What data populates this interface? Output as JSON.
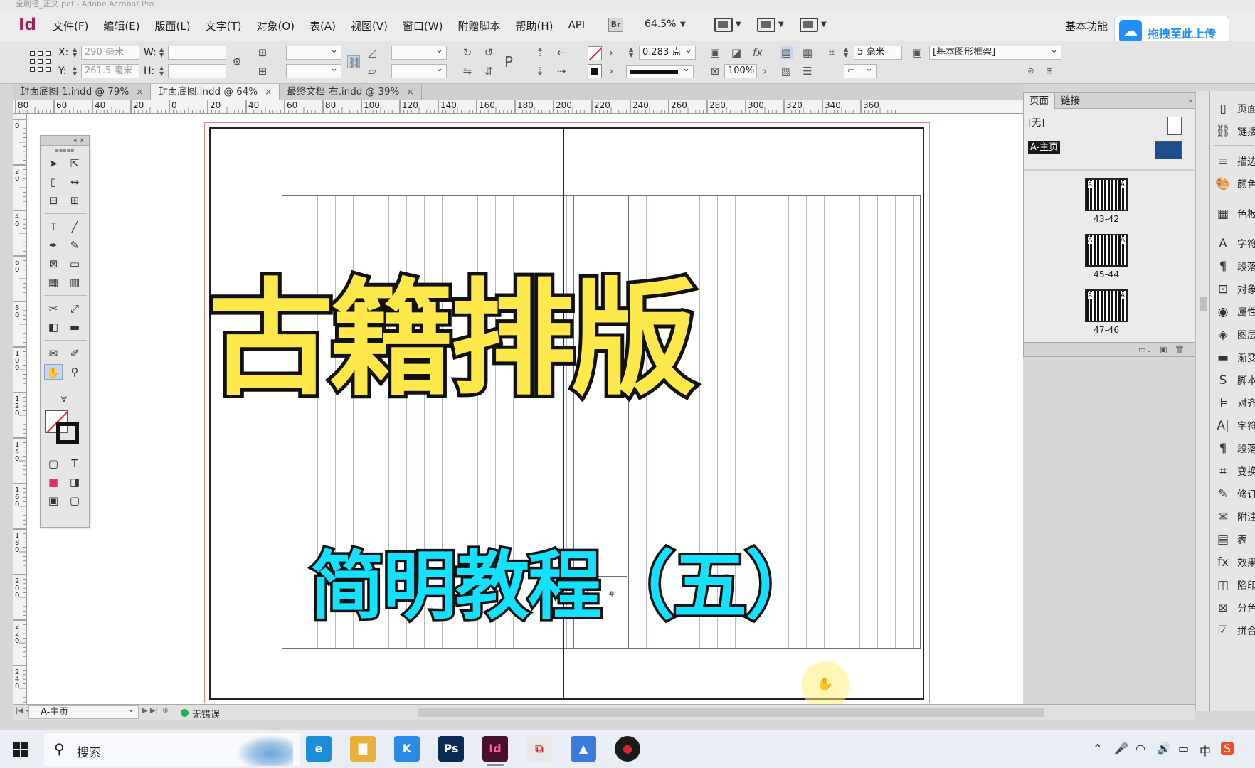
{
  "app": {
    "logo": "Id",
    "title_strip": "全刷径_正文.pdf - Adobe Acrobat Pro",
    "menus": [
      "文件(F)",
      "编辑(E)",
      "版面(L)",
      "文字(T)",
      "对象(O)",
      "表(A)",
      "视图(V)",
      "窗口(W)",
      "附赠脚本",
      "帮助(H)",
      "API"
    ],
    "bridge_badge": "Br",
    "zoom": "64.5%",
    "workspace": "基本功能",
    "upload_button": "拖拽至此上传"
  },
  "control": {
    "x_label": "X:",
    "x_value": "290 毫米",
    "y_label": "Y:",
    "y_value": "261.5 毫米",
    "w_label": "W:",
    "h_label": "H:",
    "stroke_weight": "0.283 点",
    "opacity": "100%",
    "offset": "5 毫米",
    "object_style": "[基本图形框架]"
  },
  "tabs": [
    {
      "label": "封面底图-1.indd @ 79%",
      "active": false
    },
    {
      "label": "封面底图.indd @ 64%",
      "active": true
    },
    {
      "label": "最终文档-右.indd @ 39%",
      "active": false
    }
  ],
  "ruler_h": [
    "80",
    "60",
    "40",
    "20",
    "0",
    "20",
    "40",
    "60",
    "80",
    "100",
    "120",
    "140",
    "160",
    "180",
    "200",
    "220",
    "240",
    "260",
    "280",
    "300",
    "320",
    "340",
    "360"
  ],
  "ruler_v": [
    "0",
    "20",
    "40",
    "60",
    "80",
    "100",
    "120",
    "140",
    "160",
    "180",
    "200",
    "220",
    "240"
  ],
  "canvas": {
    "title": "古籍排版",
    "subtitle": "简明教程（五）",
    "center_marks": [
      "#",
      "#"
    ],
    "title_color": "#ffe94a",
    "subtitle_color": "#14e0ff"
  },
  "pages_panel": {
    "tabs": [
      "页面",
      "链接"
    ],
    "masters": [
      "[无]",
      "A-主页"
    ],
    "spreads": [
      "43-42",
      "45-44",
      "47-46"
    ]
  },
  "dock": [
    "页面",
    "链接",
    "描边",
    "颜色",
    "色板",
    "字符",
    "段落",
    "对象",
    "属性",
    "图层",
    "渐变",
    "脚本",
    "对齐",
    "字符",
    "段落",
    "变换",
    "修订",
    "附注",
    "表",
    "效果",
    "陷印",
    "分色",
    "拼合"
  ],
  "status": {
    "page": "A-主页",
    "preflight": "无错误"
  },
  "taskbar": {
    "search": "搜索",
    "apps": [
      {
        "name": "edge",
        "glyph": "e",
        "color": "#1a8fd8"
      },
      {
        "name": "files",
        "glyph": "▇",
        "color": "#e8b23a"
      },
      {
        "name": "k-app",
        "glyph": "K",
        "color": "#2a8be6"
      },
      {
        "name": "photoshop",
        "glyph": "Ps",
        "color": "#0b2a55"
      },
      {
        "name": "indesign",
        "glyph": "Id",
        "color": "#4a0f2a"
      },
      {
        "name": "acrobat",
        "glyph": "⧉",
        "color": "#e8e8e8"
      },
      {
        "name": "photos",
        "glyph": "▲",
        "color": "#3a7ad8"
      },
      {
        "name": "recorder",
        "glyph": "●",
        "color": "#1a1a1a"
      }
    ],
    "tray": [
      "⌃",
      "🎤",
      "◠",
      "🔊",
      "▭",
      "中",
      "S"
    ]
  }
}
